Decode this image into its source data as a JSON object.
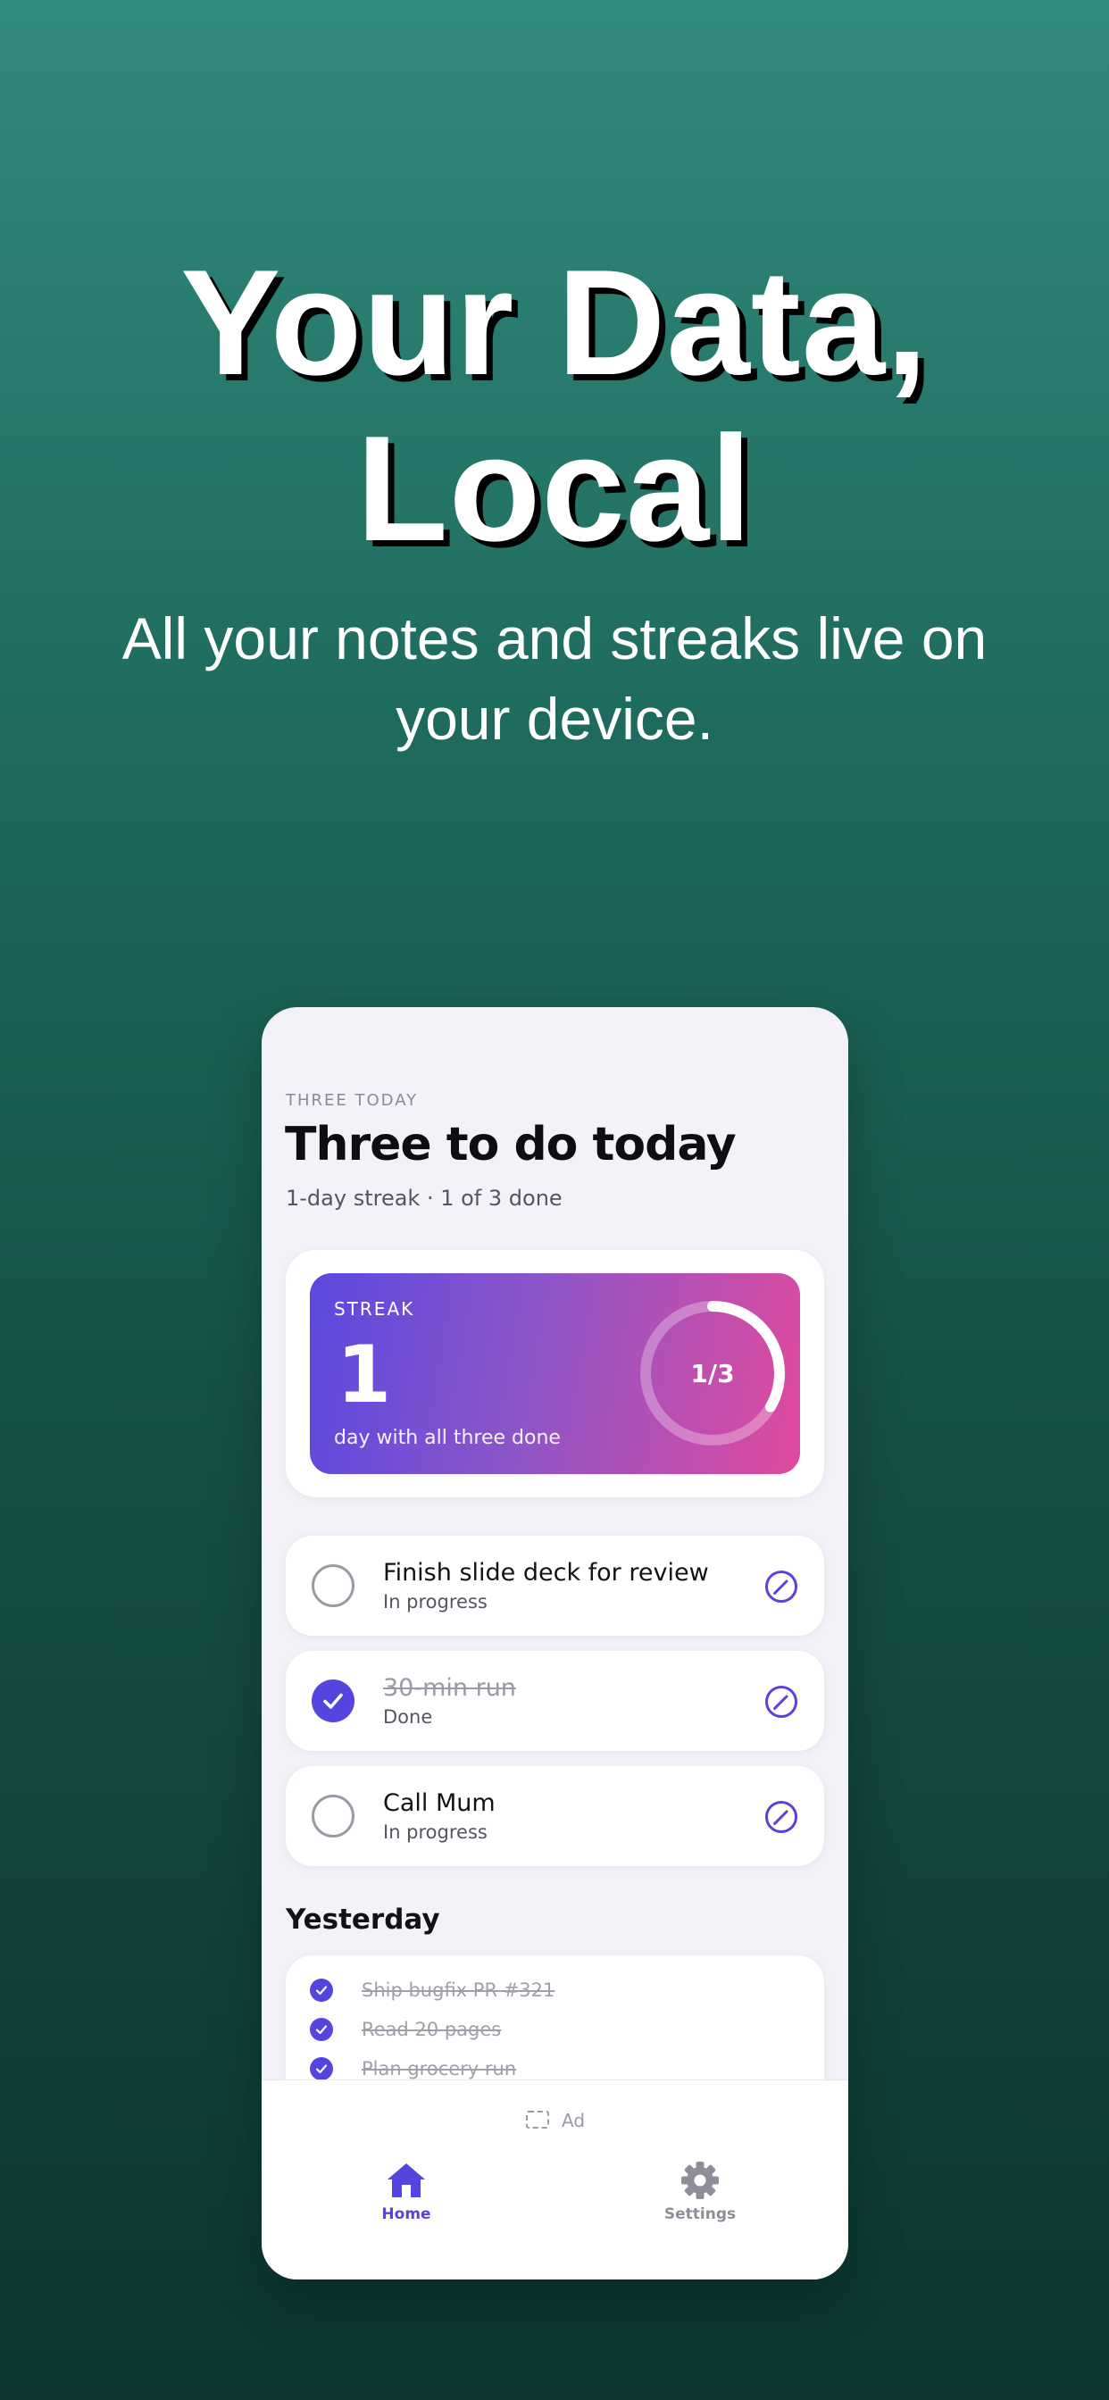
{
  "hero": {
    "title_line1": "Your Data,",
    "title_line2": "Local",
    "subtitle_line1": "All your notes and streaks live on",
    "subtitle_line2": "your device."
  },
  "app": {
    "eyebrow": "THREE TODAY",
    "title": "Three to do today",
    "subtitle": "1-day streak · 1 of 3 done"
  },
  "streak": {
    "label": "STREAK",
    "value": "1",
    "caption": "day with all three done",
    "progress_text": "1/3",
    "progress_fraction": 0.3333
  },
  "tasks": [
    {
      "title": "Finish slide deck for review",
      "status": "In progress",
      "done": false
    },
    {
      "title": "30-min run",
      "status": "Done",
      "done": true
    },
    {
      "title": "Call Mum",
      "status": "In progress",
      "done": false
    }
  ],
  "yesterday": {
    "heading": "Yesterday",
    "items": [
      "Ship bugfix PR #321",
      "Read 20 pages",
      "Plan grocery run"
    ]
  },
  "ad": {
    "label": "Ad"
  },
  "tabs": [
    {
      "label": "Home",
      "icon": "home-icon",
      "active": true
    },
    {
      "label": "Settings",
      "icon": "gear-icon",
      "active": false
    }
  ],
  "colors": {
    "accent": "#5545de",
    "gradient_start": "#5b48e0",
    "gradient_end": "#e04a9e",
    "inactive_tab": "#8e8e99"
  }
}
